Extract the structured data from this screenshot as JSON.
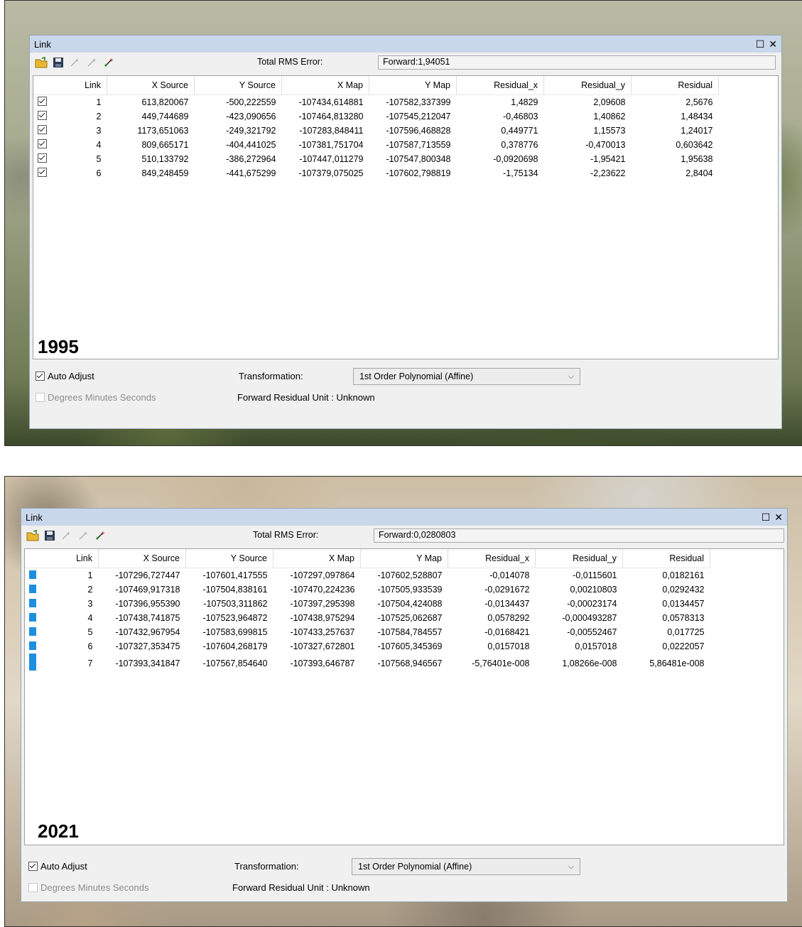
{
  "panels": [
    {
      "window_title": "Link",
      "rms_label": "Total RMS Error:",
      "rms_value": "Forward:1,94051",
      "columns": [
        "Link",
        "X Source",
        "Y Source",
        "X Map",
        "Y Map",
        "Residual_x",
        "Residual_y",
        "Residual"
      ],
      "rows": [
        [
          "1",
          "613,820067",
          "-500,222559",
          "-107434,614881",
          "-107582,337399",
          "1,4829",
          "2,09608",
          "2,5676"
        ],
        [
          "2",
          "449,744689",
          "-423,090656",
          "-107464,813280",
          "-107545,212047",
          "-0,46803",
          "1,40862",
          "1,48434"
        ],
        [
          "3",
          "1173,651063",
          "-249,321792",
          "-107283,848411",
          "-107596,468828",
          "0,449771",
          "1,15573",
          "1,24017"
        ],
        [
          "4",
          "809,665171",
          "-404,441025",
          "-107381,751704",
          "-107587,713559",
          "0,378776",
          "-0,470013",
          "0,603642"
        ],
        [
          "5",
          "510,133792",
          "-386,272964",
          "-107447,011279",
          "-107547,800348",
          "-0,0920698",
          "-1,95421",
          "1,95638"
        ],
        [
          "6",
          "849,248459",
          "-441,675299",
          "-107379,075025",
          "-107602,798819",
          "-1,75134",
          "-2,23622",
          "2,8404"
        ]
      ],
      "year": "1995",
      "auto_adjust": "Auto Adjust",
      "dms": "Degrees Minutes Seconds",
      "transformation_label": "Transformation:",
      "transformation_value": "1st Order Polynomial (Affine)",
      "residual_unit": "Forward Residual Unit : Unknown"
    },
    {
      "window_title": "Link",
      "rms_label": "Total RMS Error:",
      "rms_value": "Forward:0,0280803",
      "columns": [
        "Link",
        "X Source",
        "Y Source",
        "X Map",
        "Y Map",
        "Residual_x",
        "Residual_y",
        "Residual"
      ],
      "rows": [
        [
          "1",
          "-107296,727447",
          "-107601,417555",
          "-107297,097864",
          "-107602,528807",
          "-0,014078",
          "-0,0115601",
          "0,0182161"
        ],
        [
          "2",
          "-107469,917318",
          "-107504,838161",
          "-107470,224236",
          "-107505,933539",
          "-0,0291672",
          "0,00210803",
          "0,0292432"
        ],
        [
          "3",
          "-107396,955390",
          "-107503,311862",
          "-107397,295398",
          "-107504,424088",
          "-0,0134437",
          "-0,00023174",
          "0,0134457"
        ],
        [
          "4",
          "-107438,741875",
          "-107523,964872",
          "-107438,975294",
          "-107525,062687",
          "0,0578292",
          "-0,000493287",
          "0,0578313"
        ],
        [
          "5",
          "-107432,967954",
          "-107583,699815",
          "-107433,257637",
          "-107584,784557",
          "-0,0168421",
          "-0,00552467",
          "0,017725"
        ],
        [
          "6",
          "-107327,353475",
          "-107604,268179",
          "-107327,672801",
          "-107605,345369",
          "0,0157018",
          "0,0157018",
          "0,0222057"
        ],
        [
          "7",
          "-107393,341847",
          "-107567,854640",
          "-107393,646787",
          "-107568,946567",
          "-5,76401e-008",
          "1,08266e-008",
          "5,86481e-008"
        ]
      ],
      "year": "2021",
      "auto_adjust": "Auto Adjust",
      "dms": "Degrees Minutes Seconds",
      "transformation_label": "Transformation:",
      "transformation_value": "1st Order Polynomial (Affine)",
      "residual_unit": "Forward Residual Unit : Unknown"
    }
  ],
  "icons": {
    "open": "open-folder-icon",
    "save": "save-icon",
    "add_link": "add-control-point-icon",
    "delete_link": "delete-link-icon",
    "add_link_red": "add-link-icon",
    "maximize": "maximize-icon",
    "close": "close-icon"
  },
  "colors": {
    "title_bar": "#c9d7ea",
    "link_marker": "#1e8fe0"
  }
}
